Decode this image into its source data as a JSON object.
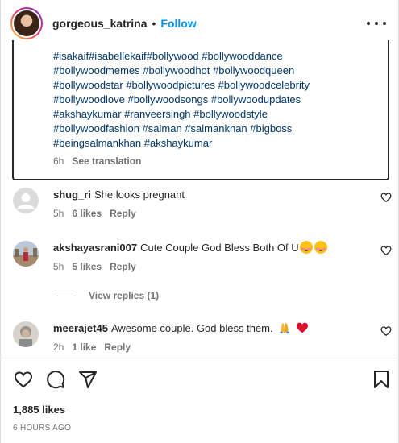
{
  "header": {
    "username": "gorgeous_katrina",
    "separator": "•",
    "follow_label": "Follow",
    "more_icon": "more-options-icon"
  },
  "caption": {
    "hashtag_lines": [
      "#isakaif#isabellekaif#bollywood #bollywooddance",
      "#bollywoodmemes #bollywoodhot #bollywoodqueen",
      "#bollywoodstar #bollywoodpictures #bollywoodcelebrity",
      "#bollywoodlove #bollywoodsongs #bollywoodupdates",
      "#akshaykumar  #ranveersingh #bollywoodstyle",
      "#bollywoodfashion #salman #salmankhan #bigboss",
      "#beingsalmankhan #akshaykumar"
    ],
    "time": "6h",
    "translation_label": "See translation"
  },
  "comments": [
    {
      "username": "shug_ri",
      "text": "She looks pregnant",
      "emojis": "",
      "time": "5h",
      "likes": "6 likes",
      "reply_label": "Reply"
    },
    {
      "username": "akshayasrani007",
      "text": "Cute Couple God Bless Both Of U",
      "emojis": "smiling-face-emoji x2",
      "time": "5h",
      "likes": "5 likes",
      "reply_label": "Reply"
    },
    {
      "username": "meerajet45",
      "text": "Awesome couple. God bless them.",
      "emojis": "folded-hands-emoji red-heart-emoji",
      "time": "2h",
      "likes": "1 like",
      "reply_label": "Reply"
    }
  ],
  "view_replies_label": "View replies (1)",
  "actions": {
    "like_icon": "heart-icon",
    "comment_icon": "comment-icon",
    "share_icon": "share-icon",
    "save_icon": "bookmark-icon"
  },
  "likes_count": "1,885 likes",
  "time_ago": "6 hours ago",
  "colors": {
    "link": "#0095f6",
    "hashtag": "#00376b",
    "muted": "#737373",
    "text": "#262626"
  }
}
